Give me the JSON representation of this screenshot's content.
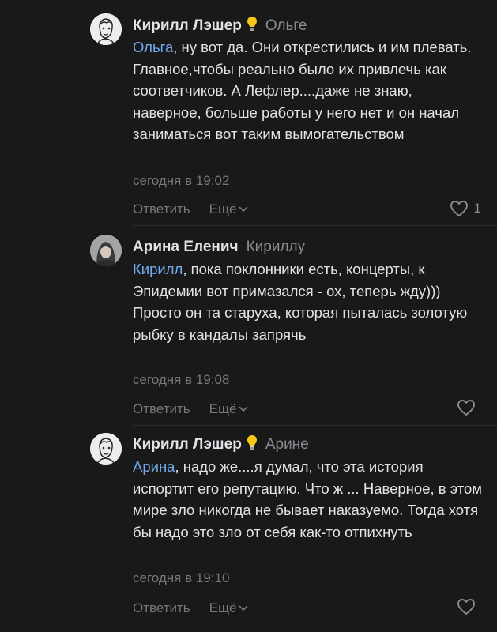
{
  "comments": [
    {
      "author": "Кирилл Лэшер",
      "reply_to": "Ольге",
      "mention": "Ольга",
      "text": ", ну вот да. Они открестились и им плевать. Главное,чтобы реально было их привлечь как соответчиков. А Лефлер....даже не знаю, наверное, больше работы у него нет и он начал заниматься вот таким вымогательством",
      "time": "сегодня в 19:02",
      "reply_label": "Ответить",
      "more_label": "Ещё",
      "likes": "1",
      "has_bulb": true
    },
    {
      "author": "Арина Еленич",
      "reply_to": "Кириллу",
      "mention": "Кирилл",
      "text": ", пока поклонники есть, концерты, к Эпидемии вот примазался - ох, теперь жду))) Просто он та старуха, которая пыталась золотую рыбку в кандалы запрячь",
      "time": "сегодня в 19:08",
      "reply_label": "Ответить",
      "more_label": "Ещё",
      "likes": "",
      "has_bulb": false
    },
    {
      "author": "Кирилл Лэшер",
      "reply_to": "Арине",
      "mention": "Арина",
      "text": ", надо же....я думал, что эта история испортит его репутацию. Что ж ... Наверное, в этом мире зло никогда не бывает наказуемо. Тогда хотя бы надо это зло от себя как-то отпихнуть",
      "time": "сегодня в 19:10",
      "reply_label": "Ответить",
      "more_label": "Ещё",
      "likes": "",
      "has_bulb": true
    }
  ],
  "icons": {
    "bulb": "lightbulb-icon",
    "heart": "heart-icon",
    "chevron": "chevron-down-icon"
  },
  "colors": {
    "background": "#19191a",
    "text": "#e1e3e6",
    "secondary": "#76787a",
    "mention": "#71aaeb",
    "bulb": "#f5c518"
  }
}
